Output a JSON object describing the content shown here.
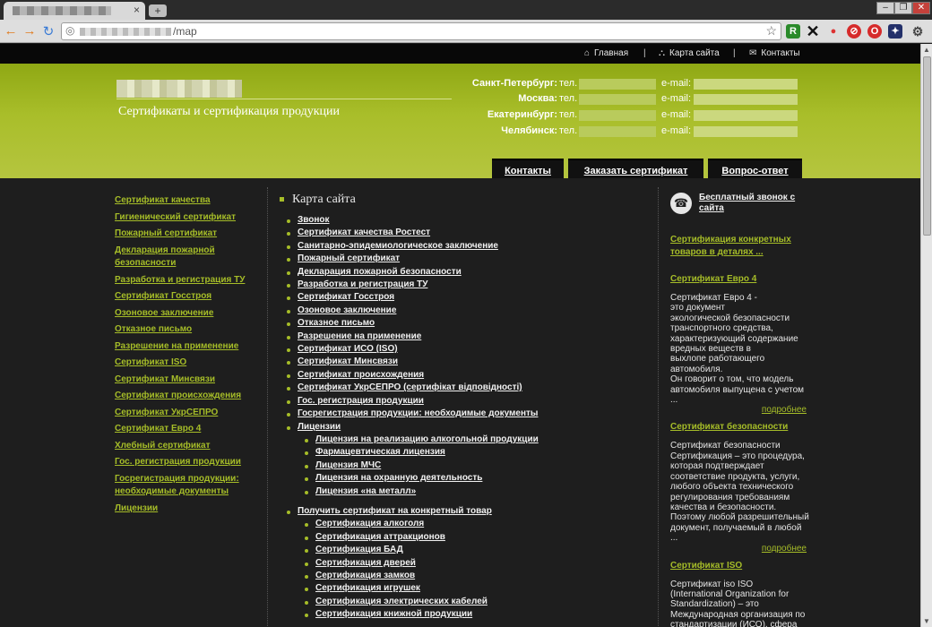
{
  "browser": {
    "url_suffix": "/map",
    "tab_close": "×",
    "new_tab": "+",
    "window_buttons": [
      "–",
      "❐",
      "✕"
    ]
  },
  "topnav": {
    "home": "Главная",
    "sitemap": "Карта сайта",
    "contacts": "Контакты",
    "sep": "|"
  },
  "header": {
    "tagline": "Сертификаты и сертификация продукции",
    "tel_label": "тел.",
    "email_label": "e-mail:",
    "cities": [
      "Санкт-Петербург:",
      "Москва:",
      "Екатеринбург:",
      "Челябинск:"
    ],
    "tabs": [
      "Контакты",
      "Заказать сертификат",
      "Вопрос-ответ"
    ]
  },
  "left_menu": [
    "Сертификат качества",
    "Гигиенический сертификат",
    "Пожарный сертификат",
    "Декларация пожарной безопасности",
    "Разработка и регистрация ТУ",
    "Сертификат Госстроя",
    "Озоновое заключение",
    "Отказное письмо",
    "Разрешение на применение",
    "Сертификат ISO",
    "Сертификат Минсвязи",
    "Сертификат происхождения",
    "Сертификат УкрСЕПРО",
    "Сертификат Евро 4",
    "Хлебный сертификат",
    "Гос. регистрация продукции",
    "Госрегистрация продукции: необходимые документы",
    "Лицензии"
  ],
  "sitemap": {
    "title": "Карта сайта",
    "items": [
      "Звонок",
      "Сертификат качества Ростест",
      "Санитарно-эпидемиологическое заключение",
      "Пожарный сертификат",
      "Декларация пожарной безопасности",
      "Разработка и регистрация ТУ",
      "Сертификат Госстроя",
      "Озоновое заключение",
      "Отказное письмо",
      "Разрешение на применение",
      "Сертификат ИСО (ISO)",
      "Сертификат Минсвязи",
      "Сертификат происхождения",
      "Сертификат УкрСЕПРО (сертифікат відповідності)",
      "Гос. регистрация продукции",
      "Госрегистрация продукции: необходимые документы"
    ],
    "licenses": "Лицензии",
    "licenses_sub": [
      "Лицензия на реализацию алкогольной продукции",
      "Фармацевтическая лицензия",
      "Лицензия МЧС",
      "Лицензия на охранную деятельность",
      "Лицензия «на металл»"
    ],
    "goods": "Получить сертификат на конкретный товар",
    "goods_sub": [
      "Сертификация алкоголя",
      "Сертификация аттракционов",
      "Сертификация БАД",
      "Сертификация дверей",
      "Сертификация замков",
      "Сертификация игрушек",
      "Сертификация электрических кабелей",
      "Сертификация книжной продукции"
    ]
  },
  "right": {
    "call": "Бесплатный звонок с сайта",
    "details_link": "Сертификация конкретных товаров в деталях ...",
    "more": "подробнее",
    "articles": [
      {
        "title": "Сертификат Евро 4",
        "text": "Сертификат Евро 4 -\nэто документ\nэкологической безопасности\nтранспортного средства,\nхарактеризующий  содержание\nвредных веществ в\nвыхлопе работающего автомобиля.\nОн говорит о том, что модель\nавтомобиля выпущена с учетом\n..."
      },
      {
        "title": "Сертификат безопасности",
        "text": "Сертификат безопасности\n Сертификация  – это процедура,\nкоторая  подтверждает\nсоответствие продукта, услуги,\nлюбого объекта технического\nрегулирования  требованиям\nкачества и безопасности.\nПоэтому любой разрешительный\nдокумент, получаемый в любой\n..."
      },
      {
        "title": "Сертификат ISO",
        "text": "Сертификат iso  ISO\n(International Organization for\nStandardization) – это\nМеждународная организация по\nстандартизации (ИСО), сфера\nдеятельности которой все\nобласти, кроме электротехники и"
      }
    ]
  }
}
